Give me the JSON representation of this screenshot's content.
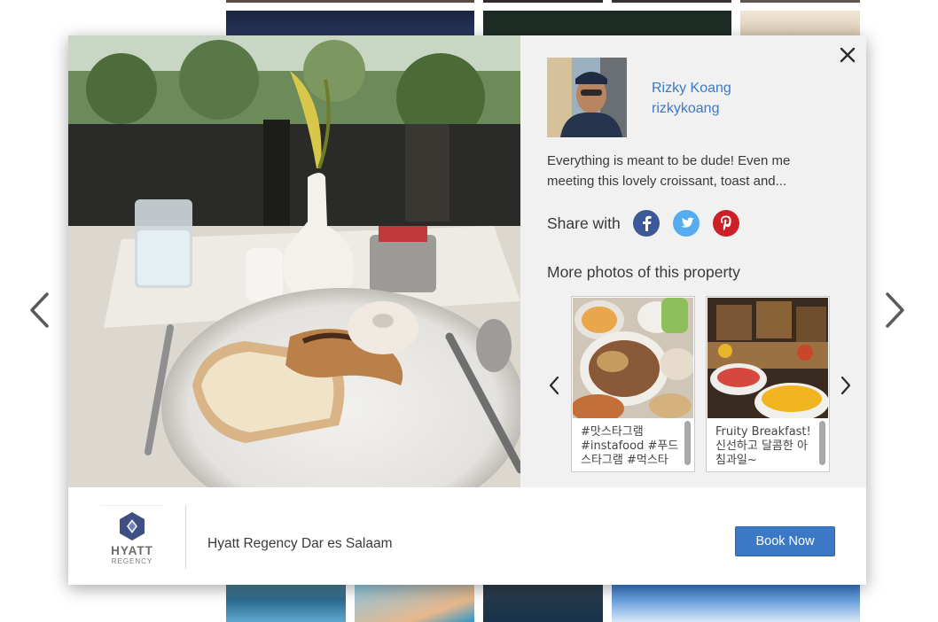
{
  "gallery": {
    "prev_label": "Previous photo",
    "next_label": "Next photo"
  },
  "post": {
    "author_name": "Rizky Koang",
    "author_handle": "rizkykoang",
    "caption": "Everything is meant to be dude! Even me meeting this lovely croissant, toast and...",
    "share_label": "Share with",
    "social_icons": [
      "facebook-icon",
      "twitter-icon",
      "pinterest-icon"
    ]
  },
  "more_photos": {
    "title": "More photos of this property",
    "items": [
      {
        "caption": "#맛스타그램 #instafood #푸드스타그램 #먹스타"
      },
      {
        "caption": "Fruity Breakfast! 신선하고 달콤한 아침과일~"
      }
    ]
  },
  "hotel": {
    "logo_word": "HYATT",
    "logo_sub": "REGENCY",
    "name": "Hyatt Regency Dar es Salaam",
    "book_label": "Book Now"
  },
  "colors": {
    "link": "#3b79c6",
    "button": "#3b79c6",
    "facebook": "#3b5998",
    "twitter": "#55acee",
    "pinterest": "#cb2027"
  }
}
